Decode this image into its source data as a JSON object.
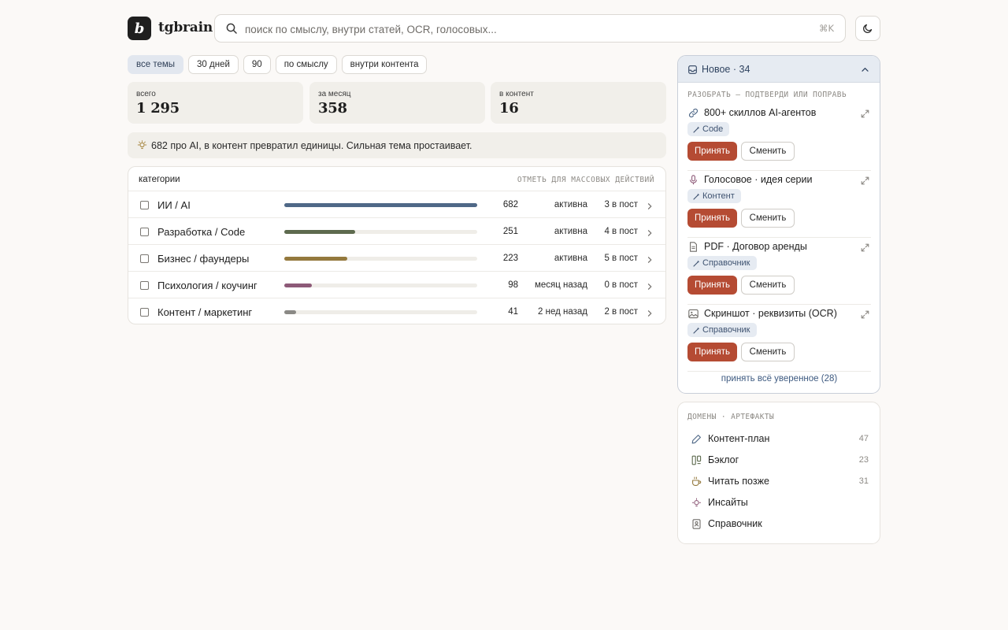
{
  "header": {
    "logo_letter": "b",
    "brand": "tgbrain",
    "search_placeholder": "поиск по смыслу, внутри статей, OCR, голосовых...",
    "search_shortcut": "⌘K"
  },
  "filters": [
    {
      "label": "все темы",
      "active": true
    },
    {
      "label": "30 дней",
      "active": false
    },
    {
      "label": "90",
      "active": false
    },
    {
      "label": "по смыслу",
      "active": false
    },
    {
      "label": "внутри контента",
      "active": false
    }
  ],
  "stats": [
    {
      "label": "всего",
      "value": "1 295"
    },
    {
      "label": "за месяц",
      "value": "358"
    },
    {
      "label": "в контент",
      "value": "16"
    }
  ],
  "insight": "682 про AI, в контент превратил единицы. Сильная тема простаивает.",
  "categories": {
    "title": "категории",
    "hint": "ОТМЕТЬ ДЛЯ МАССОВЫХ ДЕЙСТВИЙ",
    "max": 682,
    "rows": [
      {
        "name": "ИИ / AI",
        "count": "682",
        "value": 682,
        "status": "активна",
        "posts": "3 в пост",
        "color": "#4f6887"
      },
      {
        "name": "Разработка / Code",
        "count": "251",
        "value": 251,
        "status": "активна",
        "posts": "4 в пост",
        "color": "#5d6a4e"
      },
      {
        "name": "Бизнес / фаундеры",
        "count": "223",
        "value": 223,
        "status": "активна",
        "posts": "5 в пост",
        "color": "#94793d"
      },
      {
        "name": "Психология / коучинг",
        "count": "98",
        "value": 98,
        "status": "месяц назад",
        "posts": "0 в пост",
        "color": "#8d5a78"
      },
      {
        "name": "Контент / маркетинг",
        "count": "41",
        "value": 41,
        "status": "2 нед назад",
        "posts": "2 в пост",
        "color": "#8a8985"
      }
    ]
  },
  "new_panel": {
    "title": "Новое · 34",
    "subtitle": "РАЗОБРАТЬ — ПОДТВЕРДИ ИЛИ ПОПРАВЬ",
    "accept_label": "Принять",
    "change_label": "Сменить",
    "items": [
      {
        "title": "800+ скиллов AI-агентов",
        "tag": "Code",
        "icon": "link-icon"
      },
      {
        "title": "Голосовое · идея серии",
        "tag": "Контент",
        "icon": "microphone-icon"
      },
      {
        "title": "PDF · Договор аренды",
        "tag": "Справочник",
        "icon": "document-icon"
      },
      {
        "title": "Скриншот · реквизиты (OCR)",
        "tag": "Справочник",
        "icon": "image-icon"
      }
    ],
    "accept_all": "принять всё уверенное (28)"
  },
  "domains": {
    "subtitle": "ДОМЕНЫ · АРТЕФАКТЫ",
    "items": [
      {
        "name": "Контент-план",
        "count": "47",
        "icon": "pencil-icon"
      },
      {
        "name": "Бэклог",
        "count": "23",
        "icon": "kanban-icon"
      },
      {
        "name": "Читать позже",
        "count": "31",
        "icon": "coffee-icon"
      },
      {
        "name": "Инсайты",
        "count": "",
        "icon": "lightbulb-icon"
      },
      {
        "name": "Справочник",
        "count": "",
        "icon": "contact-book-icon"
      }
    ]
  },
  "colors": {
    "accent": "#b54b33",
    "chip_active_bg": "#e2e7ef",
    "panel_head_bg": "#e6ebf2",
    "page_bg": "#fbf9f7"
  }
}
